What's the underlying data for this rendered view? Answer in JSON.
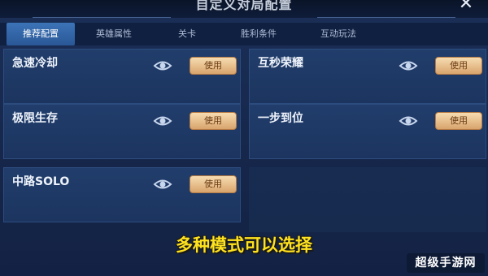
{
  "header": {
    "title": "自定义对局配置",
    "close_glyph": "✕"
  },
  "tabs": [
    {
      "label": "推荐配置",
      "active": true
    },
    {
      "label": "英雄属性",
      "active": false
    },
    {
      "label": "关卡",
      "active": false
    },
    {
      "label": "胜利条件",
      "active": false
    },
    {
      "label": "互动玩法",
      "active": false
    }
  ],
  "modes": [
    {
      "name": "急速冷却",
      "button": "使用"
    },
    {
      "name": "互秒荣耀",
      "button": "使用"
    },
    {
      "name": "极限生存",
      "button": "使用"
    },
    {
      "name": "一步到位",
      "button": "使用"
    },
    {
      "name": "中路SOLO",
      "button": "使用"
    }
  ],
  "caption": "多种模式可以选择",
  "watermark": "超级手游网",
  "icons": {
    "preview": "eye-icon",
    "close": "close-icon"
  },
  "colors": {
    "accent_tab": "#3c74b8",
    "use_button": "#e7bd85",
    "caption": "#ffe21e"
  }
}
